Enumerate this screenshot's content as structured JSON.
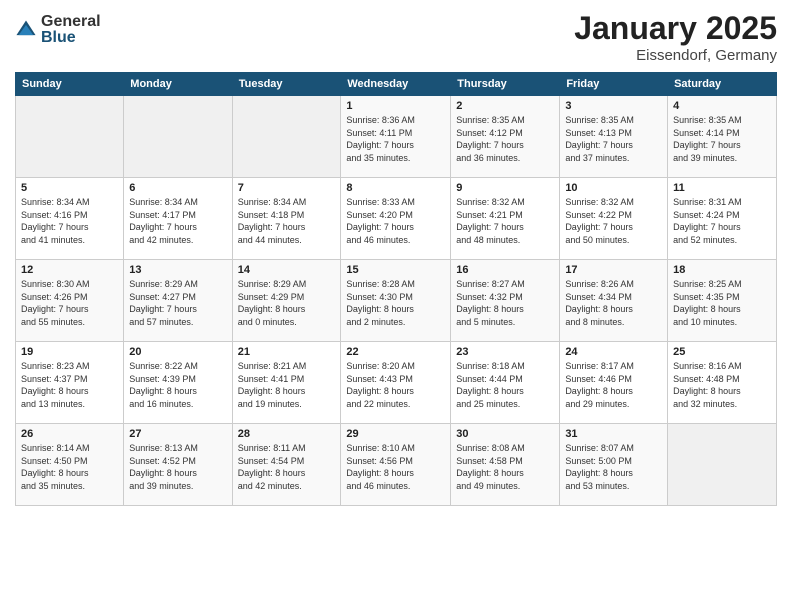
{
  "logo": {
    "general": "General",
    "blue": "Blue"
  },
  "title": "January 2025",
  "subtitle": "Eissendorf, Germany",
  "weekdays": [
    "Sunday",
    "Monday",
    "Tuesday",
    "Wednesday",
    "Thursday",
    "Friday",
    "Saturday"
  ],
  "weeks": [
    [
      {
        "day": "",
        "info": ""
      },
      {
        "day": "",
        "info": ""
      },
      {
        "day": "",
        "info": ""
      },
      {
        "day": "1",
        "info": "Sunrise: 8:36 AM\nSunset: 4:11 PM\nDaylight: 7 hours\nand 35 minutes."
      },
      {
        "day": "2",
        "info": "Sunrise: 8:35 AM\nSunset: 4:12 PM\nDaylight: 7 hours\nand 36 minutes."
      },
      {
        "day": "3",
        "info": "Sunrise: 8:35 AM\nSunset: 4:13 PM\nDaylight: 7 hours\nand 37 minutes."
      },
      {
        "day": "4",
        "info": "Sunrise: 8:35 AM\nSunset: 4:14 PM\nDaylight: 7 hours\nand 39 minutes."
      }
    ],
    [
      {
        "day": "5",
        "info": "Sunrise: 8:34 AM\nSunset: 4:16 PM\nDaylight: 7 hours\nand 41 minutes."
      },
      {
        "day": "6",
        "info": "Sunrise: 8:34 AM\nSunset: 4:17 PM\nDaylight: 7 hours\nand 42 minutes."
      },
      {
        "day": "7",
        "info": "Sunrise: 8:34 AM\nSunset: 4:18 PM\nDaylight: 7 hours\nand 44 minutes."
      },
      {
        "day": "8",
        "info": "Sunrise: 8:33 AM\nSunset: 4:20 PM\nDaylight: 7 hours\nand 46 minutes."
      },
      {
        "day": "9",
        "info": "Sunrise: 8:32 AM\nSunset: 4:21 PM\nDaylight: 7 hours\nand 48 minutes."
      },
      {
        "day": "10",
        "info": "Sunrise: 8:32 AM\nSunset: 4:22 PM\nDaylight: 7 hours\nand 50 minutes."
      },
      {
        "day": "11",
        "info": "Sunrise: 8:31 AM\nSunset: 4:24 PM\nDaylight: 7 hours\nand 52 minutes."
      }
    ],
    [
      {
        "day": "12",
        "info": "Sunrise: 8:30 AM\nSunset: 4:26 PM\nDaylight: 7 hours\nand 55 minutes."
      },
      {
        "day": "13",
        "info": "Sunrise: 8:29 AM\nSunset: 4:27 PM\nDaylight: 7 hours\nand 57 minutes."
      },
      {
        "day": "14",
        "info": "Sunrise: 8:29 AM\nSunset: 4:29 PM\nDaylight: 8 hours\nand 0 minutes."
      },
      {
        "day": "15",
        "info": "Sunrise: 8:28 AM\nSunset: 4:30 PM\nDaylight: 8 hours\nand 2 minutes."
      },
      {
        "day": "16",
        "info": "Sunrise: 8:27 AM\nSunset: 4:32 PM\nDaylight: 8 hours\nand 5 minutes."
      },
      {
        "day": "17",
        "info": "Sunrise: 8:26 AM\nSunset: 4:34 PM\nDaylight: 8 hours\nand 8 minutes."
      },
      {
        "day": "18",
        "info": "Sunrise: 8:25 AM\nSunset: 4:35 PM\nDaylight: 8 hours\nand 10 minutes."
      }
    ],
    [
      {
        "day": "19",
        "info": "Sunrise: 8:23 AM\nSunset: 4:37 PM\nDaylight: 8 hours\nand 13 minutes."
      },
      {
        "day": "20",
        "info": "Sunrise: 8:22 AM\nSunset: 4:39 PM\nDaylight: 8 hours\nand 16 minutes."
      },
      {
        "day": "21",
        "info": "Sunrise: 8:21 AM\nSunset: 4:41 PM\nDaylight: 8 hours\nand 19 minutes."
      },
      {
        "day": "22",
        "info": "Sunrise: 8:20 AM\nSunset: 4:43 PM\nDaylight: 8 hours\nand 22 minutes."
      },
      {
        "day": "23",
        "info": "Sunrise: 8:18 AM\nSunset: 4:44 PM\nDaylight: 8 hours\nand 25 minutes."
      },
      {
        "day": "24",
        "info": "Sunrise: 8:17 AM\nSunset: 4:46 PM\nDaylight: 8 hours\nand 29 minutes."
      },
      {
        "day": "25",
        "info": "Sunrise: 8:16 AM\nSunset: 4:48 PM\nDaylight: 8 hours\nand 32 minutes."
      }
    ],
    [
      {
        "day": "26",
        "info": "Sunrise: 8:14 AM\nSunset: 4:50 PM\nDaylight: 8 hours\nand 35 minutes."
      },
      {
        "day": "27",
        "info": "Sunrise: 8:13 AM\nSunset: 4:52 PM\nDaylight: 8 hours\nand 39 minutes."
      },
      {
        "day": "28",
        "info": "Sunrise: 8:11 AM\nSunset: 4:54 PM\nDaylight: 8 hours\nand 42 minutes."
      },
      {
        "day": "29",
        "info": "Sunrise: 8:10 AM\nSunset: 4:56 PM\nDaylight: 8 hours\nand 46 minutes."
      },
      {
        "day": "30",
        "info": "Sunrise: 8:08 AM\nSunset: 4:58 PM\nDaylight: 8 hours\nand 49 minutes."
      },
      {
        "day": "31",
        "info": "Sunrise: 8:07 AM\nSunset: 5:00 PM\nDaylight: 8 hours\nand 53 minutes."
      },
      {
        "day": "",
        "info": ""
      }
    ]
  ]
}
